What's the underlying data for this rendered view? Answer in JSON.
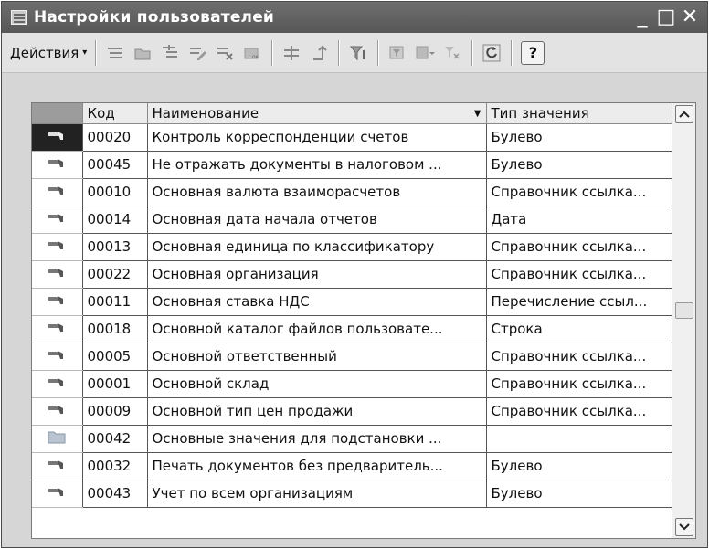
{
  "window": {
    "title": "Настройки пользователей",
    "controls": {
      "minimize": "_",
      "maximize": "□",
      "close": "✕"
    }
  },
  "toolbar": {
    "actions_label": "Действия",
    "actions_arrow": "▾",
    "help_label": "?",
    "icons": [
      "add-icon",
      "add-folder-icon",
      "copy-icon",
      "edit-icon",
      "delete-icon",
      "mark-delete-icon",
      "hierarchy-icon",
      "up-level-icon",
      "filter-icon",
      "filter-list-icon",
      "filter-history-icon",
      "clear-filter-icon",
      "refresh-icon",
      "help-icon"
    ]
  },
  "table": {
    "columns": {
      "code": "Код",
      "name": "Наименование",
      "type": "Тип значения"
    },
    "sort_indicator": "▼",
    "rows": [
      {
        "icon": "item",
        "code": "00020",
        "name": "Контроль корреспонденции счетов",
        "type": "Булево",
        "selected": true
      },
      {
        "icon": "item",
        "code": "00045",
        "name": "Не отражать документы в налоговом ...",
        "type": "Булево"
      },
      {
        "icon": "item",
        "code": "00010",
        "name": "Основная валюта взаиморасчетов",
        "type": "Справочник ссылка..."
      },
      {
        "icon": "item",
        "code": "00014",
        "name": "Основная дата начала отчетов",
        "type": "Дата"
      },
      {
        "icon": "item",
        "code": "00013",
        "name": "Основная единица по классификатору",
        "type": "Справочник ссылка..."
      },
      {
        "icon": "item",
        "code": "00022",
        "name": "Основная организация",
        "type": "Справочник ссылка..."
      },
      {
        "icon": "item",
        "code": "00011",
        "name": "Основная ставка НДС",
        "type": "Перечисление ссыл..."
      },
      {
        "icon": "item",
        "code": "00018",
        "name": "Основной каталог файлов пользовате...",
        "type": "Строка"
      },
      {
        "icon": "item",
        "code": "00005",
        "name": "Основной ответственный",
        "type": "Справочник ссылка..."
      },
      {
        "icon": "item",
        "code": "00001",
        "name": "Основной склад",
        "type": "Справочник ссылка..."
      },
      {
        "icon": "item",
        "code": "00009",
        "name": "Основной тип цен продажи",
        "type": "Справочник ссылка..."
      },
      {
        "icon": "folder",
        "code": "00042",
        "name": "Основные значения для подстановки ...",
        "type": ""
      },
      {
        "icon": "item",
        "code": "00032",
        "name": "Печать документов без предваритель...",
        "type": "Булево"
      },
      {
        "icon": "item",
        "code": "00043",
        "name": "Учет по всем организациям",
        "type": "Булево"
      }
    ]
  },
  "scrollbar": {
    "up": "▲",
    "down": "▼"
  }
}
